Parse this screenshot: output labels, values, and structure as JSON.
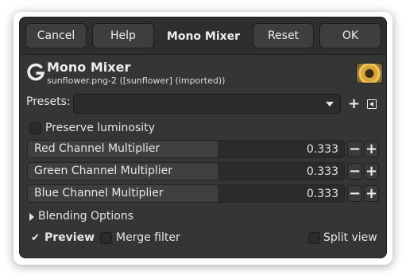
{
  "header": {
    "cancel_label": "Cancel",
    "help_label": "Help",
    "title": "Mono Mixer",
    "reset_label": "Reset",
    "ok_label": "OK"
  },
  "operation": {
    "title": "Mono Mixer",
    "subtitle": "sunflower.png-2 ([sunflower] (imported))",
    "logo_letter": "G"
  },
  "presets": {
    "label": "Presets:",
    "value": ""
  },
  "preserve_luminosity": {
    "label": "Preserve luminosity",
    "checked": false
  },
  "channels": [
    {
      "label": "Red Channel Multiplier",
      "value": "0.333",
      "fraction": 0.6
    },
    {
      "label": "Green Channel Multiplier",
      "value": "0.333",
      "fraction": 0.6
    },
    {
      "label": "Blue Channel Multiplier",
      "value": "0.333",
      "fraction": 0.6
    }
  ],
  "blending": {
    "label": "Blending Options",
    "expanded": false
  },
  "footer": {
    "preview_label": "Preview",
    "preview_checked": true,
    "merge_label": "Merge filter",
    "merge_checked": false,
    "split_label": "Split view",
    "split_checked": false
  },
  "colors": {
    "dialog_bg": "#353535",
    "header_bg": "#2e2e2e",
    "entry_bg": "#2b2b2b",
    "text": "#e6e6e6"
  },
  "icons": {
    "presets_add": "plus-icon",
    "presets_menu": "menu-triangle-icon",
    "decrease": "minus-icon",
    "increase": "plus-icon",
    "expander": "triangle-right-icon",
    "check": "checkmark-icon"
  }
}
